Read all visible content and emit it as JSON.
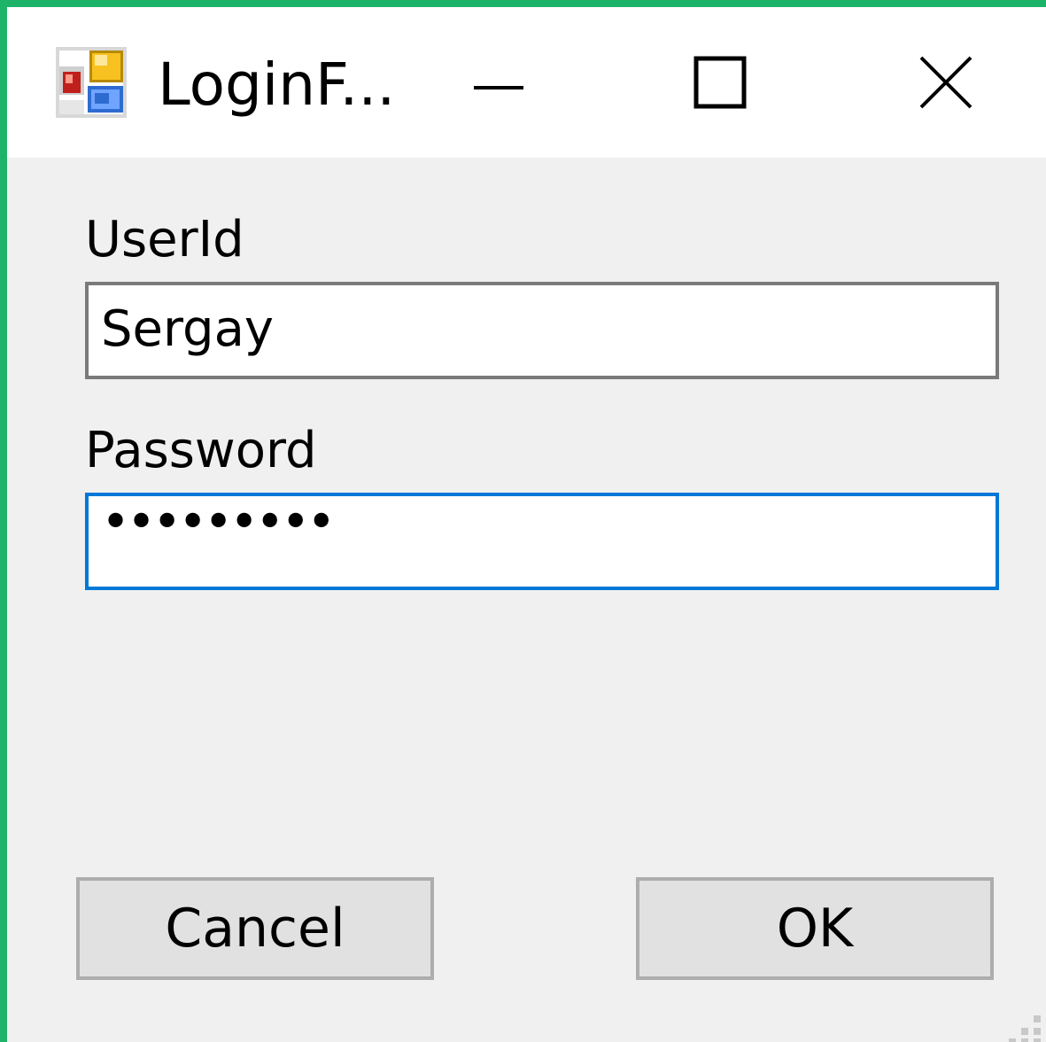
{
  "window": {
    "title": "LoginF...",
    "accent_color": "#1db46a"
  },
  "icons": {
    "app": "winforms-app-icon",
    "minimize": "minimize-icon",
    "maximize": "maximize-icon",
    "close": "close-icon",
    "grip": "resize-grip-icon"
  },
  "form": {
    "userid_label": "UserId",
    "userid_value": "Sergay",
    "password_label": "Password",
    "password_value": "•••••••••",
    "focus_color": "#0078d7"
  },
  "buttons": {
    "cancel_label": "Cancel",
    "ok_label": "OK"
  }
}
